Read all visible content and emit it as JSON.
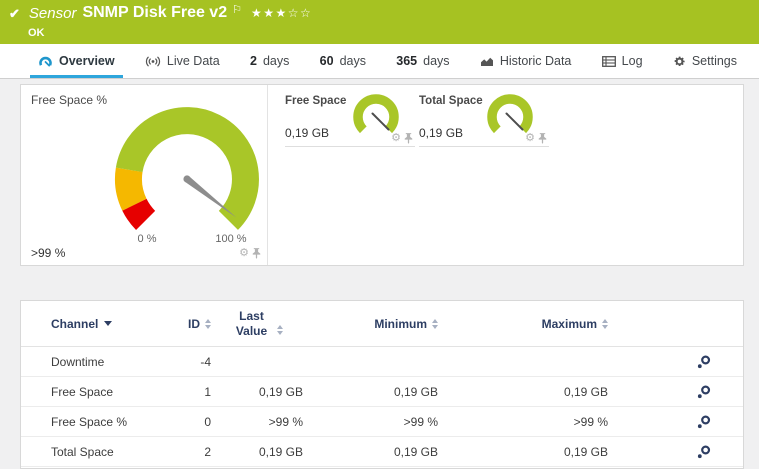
{
  "header": {
    "kind": "Sensor",
    "title": "SNMP Disk Free v2",
    "status": "OK",
    "stars": "★★★☆☆",
    "bar_color": "#a6c222"
  },
  "icons": {
    "check": "✔",
    "flag": "⚐",
    "gear_glyph": "⚙"
  },
  "tabs": [
    {
      "label": "Overview",
      "active": true
    },
    {
      "label": "Live Data"
    },
    {
      "num": "2",
      "label": "days"
    },
    {
      "num": "60",
      "label": "days"
    },
    {
      "num": "365",
      "label": "days"
    },
    {
      "label": "Historic Data"
    },
    {
      "label": "Log"
    },
    {
      "label": "Settings"
    }
  ],
  "overview": {
    "main_gauge": {
      "title": "Free Space %",
      "current": ">99 %",
      "scale_min": "0 %",
      "scale_max": "100 %",
      "needle_percent": 97,
      "colors": {
        "green": "#a9c628",
        "yellow": "#f5b800",
        "red": "#e60000",
        "needle": "#8d8d8d"
      }
    },
    "minis": [
      {
        "title": "Free Space",
        "value": "0,19 GB"
      },
      {
        "title": "Total Space",
        "value": "0,19 GB"
      }
    ]
  },
  "table": {
    "columns": {
      "channel": "Channel",
      "id": "ID",
      "last": "Last Value",
      "min": "Minimum",
      "max": "Maximum"
    },
    "rows": [
      {
        "channel": "Downtime",
        "id": "-4",
        "last": "",
        "min": "",
        "max": ""
      },
      {
        "channel": "Free Space",
        "id": "1",
        "last": "0,19 GB",
        "min": "0,19 GB",
        "max": "0,19 GB"
      },
      {
        "channel": "Free Space %",
        "id": "0",
        "last": ">99 %",
        "min": ">99 %",
        "max": ">99 %"
      },
      {
        "channel": "Total Space",
        "id": "2",
        "last": "0,19 GB",
        "min": "0,19 GB",
        "max": "0,19 GB"
      }
    ]
  }
}
